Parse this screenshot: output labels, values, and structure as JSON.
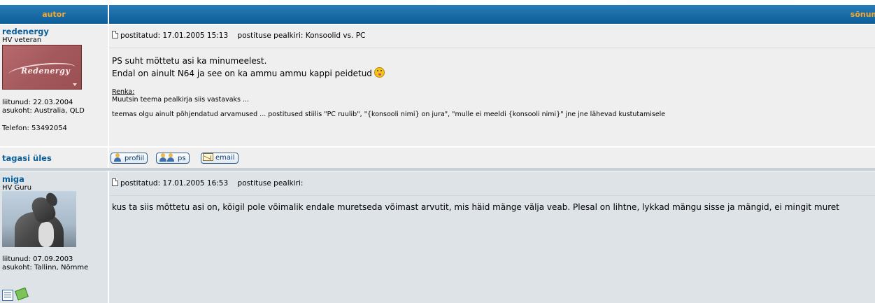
{
  "header": {
    "author_col": "autor",
    "message_col": "sõnum"
  },
  "posts": [
    {
      "username": "redenergy",
      "rank": "HV veteran",
      "avatar_text": "Redenergy",
      "joined": "liitunud: 22.03.2004",
      "location": "asukoht: Australia, QLD",
      "phone": "Telefon: 53492054",
      "posted": "postitatud: 17.01.2005 15:13",
      "subject": "postituse pealkiri: Konsoolid vs. PC",
      "body_line1": "PS suht möttetu asi ka minumeelest.",
      "body_line2": "Endal on ainult N64 ja see on ka ammu ammu kappi peidetud",
      "edit_title": "Renka:",
      "edit_line1": "Muutsin teema pealkirja siis vastavaks ...",
      "edit_line2": "teemas olgu ainult põhjendatud arvamused ... postitused stiilis \"PC ruulib\", \"{konsooli nimi} on jura\", \"mulle ei meeldi {konsooli nimi}\" jne jne lähevad kustutamisele"
    },
    {
      "username": "miga",
      "rank": "HV Guru",
      "joined": "liitunud: 07.09.2003",
      "location": "asukoht: Tallinn, Nõmme",
      "posted": "postitatud: 17.01.2005 16:53",
      "subject": "postituse pealkiri:",
      "body": "kus ta siis mõttetu asi on, kõigil pole võimalik endale muretseda võimast arvutit, mis häid mänge välja veab. Plesal on lihtne, lykkad mängu sisse ja mängid, ei mingit muret"
    }
  ],
  "footer_row": {
    "back_to_top": "tagasi üles",
    "profile_btn": "profiil",
    "pm_btn": "ps",
    "email_btn": "email"
  },
  "colors": {
    "header_gradient_top": "#2a7bb6",
    "header_text": "#f7a92e",
    "link": "#0b5e98",
    "row1_bg": "#efefef",
    "row2_bg": "#dee3e7"
  }
}
